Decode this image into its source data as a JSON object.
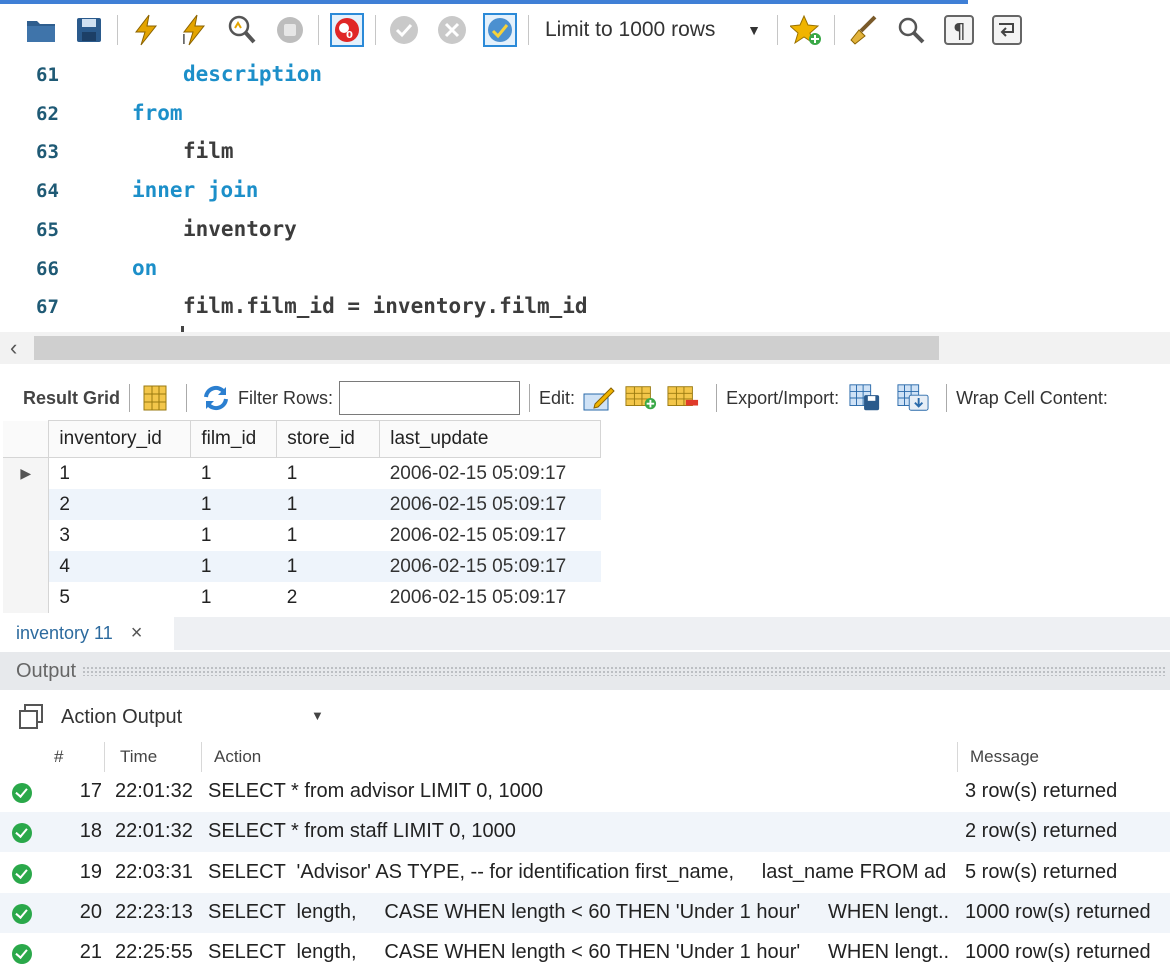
{
  "toolbar": {
    "limit_label": "Limit to 1000 rows",
    "icons": [
      "folder-open-icon",
      "save-icon",
      "execute-icon",
      "execute-current-icon",
      "explain-icon",
      "stop-icon",
      "toggle-stop-on-error-icon",
      "commit-icon",
      "rollback-icon",
      "autocommit-icon",
      "limit-rows-dropdown",
      "bookmark-star-icon",
      "beautify-icon",
      "find-icon",
      "invisible-chars-icon",
      "wrap-lines-icon"
    ]
  },
  "editor": {
    "lines": [
      {
        "num": "61",
        "indent": 2,
        "tokens": [
          {
            "text": "description",
            "kind": "kw"
          }
        ]
      },
      {
        "num": "62",
        "indent": 1,
        "tokens": [
          {
            "text": "from",
            "kind": "kw"
          }
        ]
      },
      {
        "num": "63",
        "indent": 2,
        "tokens": [
          {
            "text": "film",
            "kind": "id"
          }
        ]
      },
      {
        "num": "64",
        "indent": 1,
        "tokens": [
          {
            "text": "inner join",
            "kind": "kw"
          }
        ]
      },
      {
        "num": "65",
        "indent": 2,
        "tokens": [
          {
            "text": "inventory",
            "kind": "id"
          }
        ]
      },
      {
        "num": "66",
        "indent": 1,
        "tokens": [
          {
            "text": "on",
            "kind": "kw"
          }
        ]
      },
      {
        "num": "67",
        "indent": 2,
        "tokens": [
          {
            "text": "film.film_id = inventory.film_id",
            "kind": "id"
          }
        ]
      }
    ]
  },
  "result_toolbar": {
    "result_grid_label": "Result Grid",
    "filter_rows_label": "Filter Rows:",
    "filter_rows_value": "",
    "edit_label": "Edit:",
    "export_import_label": "Export/Import:",
    "wrap_cell_label": "Wrap Cell Content:"
  },
  "grid": {
    "columns": [
      "inventory_id",
      "film_id",
      "store_id",
      "last_update"
    ],
    "rows": [
      [
        "1",
        "1",
        "1",
        "2006-02-15 05:09:17"
      ],
      [
        "2",
        "1",
        "1",
        "2006-02-15 05:09:17"
      ],
      [
        "3",
        "1",
        "1",
        "2006-02-15 05:09:17"
      ],
      [
        "4",
        "1",
        "1",
        "2006-02-15 05:09:17"
      ],
      [
        "5",
        "1",
        "2",
        "2006-02-15 05:09:17"
      ]
    ]
  },
  "tabs": [
    {
      "label": "inventory 11",
      "close": "×"
    }
  ],
  "output": {
    "title": "Output",
    "mode": "Action Output",
    "columns": {
      "num": "#",
      "time": "Time",
      "action": "Action",
      "message": "Message"
    },
    "rows": [
      {
        "num": "17",
        "time": "22:01:32",
        "action": "SELECT * from advisor LIMIT 0, 1000",
        "message": "3 row(s) returned"
      },
      {
        "num": "18",
        "time": "22:01:32",
        "action": "SELECT * from staff LIMIT 0, 1000",
        "message": "2 row(s) returned"
      },
      {
        "num": "19",
        "time": "22:03:31",
        "action": "SELECT  'Advisor' AS TYPE, -- for identification first_name,     last_name FROM ad...",
        "message": "5 row(s) returned"
      },
      {
        "num": "20",
        "time": "22:23:13",
        "action": "SELECT  length,     CASE WHEN length < 60 THEN 'Under 1 hour'     WHEN lengt...",
        "message": "1000 row(s) returned"
      },
      {
        "num": "21",
        "time": "22:25:55",
        "action": "SELECT  length,     CASE WHEN length < 60 THEN 'Under 1 hour'     WHEN lengt...",
        "message": "1000 row(s) returned"
      }
    ]
  }
}
